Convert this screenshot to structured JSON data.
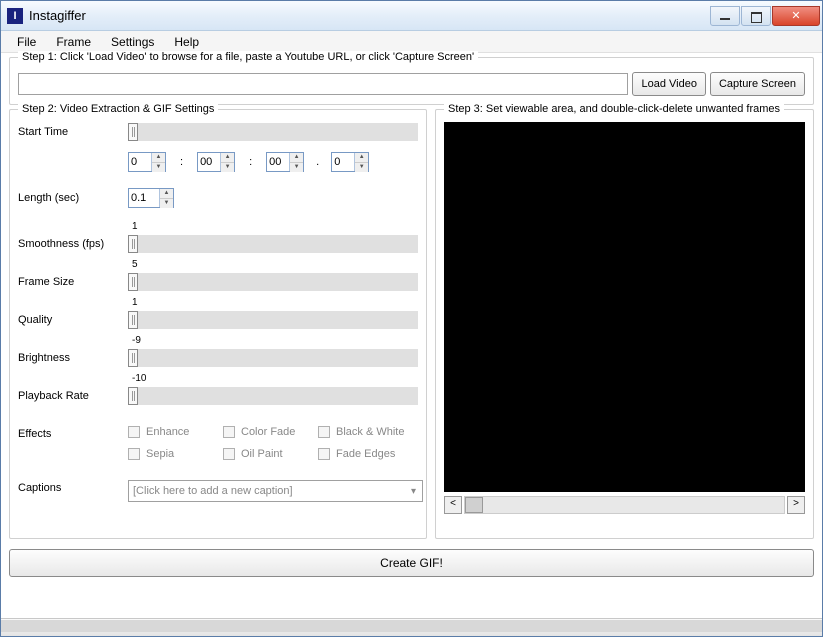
{
  "window": {
    "title": "Instagiffer",
    "icon_letter": "I"
  },
  "menu": {
    "file": "File",
    "frame": "Frame",
    "settings": "Settings",
    "help": "Help"
  },
  "step1": {
    "legend": "Step 1: Click 'Load Video' to browse for a file, paste a Youtube URL, or click 'Capture Screen'",
    "url_value": "",
    "load_video": "Load Video",
    "capture_screen": "Capture Screen"
  },
  "step2": {
    "legend": "Step 2: Video Extraction & GIF Settings",
    "start_time_label": "Start Time",
    "time_h": "0",
    "time_m": "00",
    "time_s": "00",
    "time_ms": "0",
    "length_label": "Length (sec)",
    "length_value": "0.1",
    "smoothness_label": "Smoothness (fps)",
    "smoothness_value": "1",
    "frame_size_label": "Frame Size",
    "frame_size_value": "5",
    "quality_label": "Quality",
    "quality_value": "1",
    "brightness_label": "Brightness",
    "brightness_value": "-9",
    "playback_label": "Playback Rate",
    "playback_value": "-10",
    "effects_label": "Effects",
    "effects": {
      "enhance": "Enhance",
      "color_fade": "Color Fade",
      "bw": "Black & White",
      "sepia": "Sepia",
      "oil_paint": "Oil Paint",
      "fade_edges": "Fade Edges"
    },
    "captions_label": "Captions",
    "captions_placeholder": "[Click here to add a new caption]"
  },
  "step3": {
    "legend": "Step 3: Set viewable area, and double-click-delete unwanted frames",
    "scroll_left": "<",
    "scroll_right": ">"
  },
  "create_label": "Create GIF!"
}
